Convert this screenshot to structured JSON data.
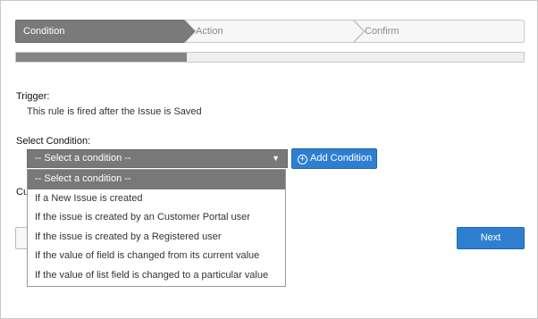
{
  "wizard": {
    "steps": [
      {
        "label": "Condition",
        "state": "active"
      },
      {
        "label": "Action",
        "state": "inactive"
      },
      {
        "label": "Confirm",
        "state": "inactive"
      }
    ],
    "progress_fraction": 0.336
  },
  "trigger": {
    "label": "Trigger:",
    "text": "This rule is fired after the Issue is Saved"
  },
  "condition": {
    "label": "Select Condition:",
    "selected": "-- Select a condition --",
    "add_button": "Add Condition",
    "options": [
      "-- Select a condition --",
      "If a New Issue is created",
      "If the issue is created by an Customer Portal user",
      "If the issue is created by a Registered user",
      "If the value of field is changed from its current value",
      "If the value of list field is changed to a particular value"
    ]
  },
  "partial_label": "Cu",
  "footer": {
    "next_label": "Next"
  },
  "colors": {
    "active_step": "#7a7a7a",
    "primary_button": "#2f7fd1",
    "select_bg": "#787878"
  }
}
